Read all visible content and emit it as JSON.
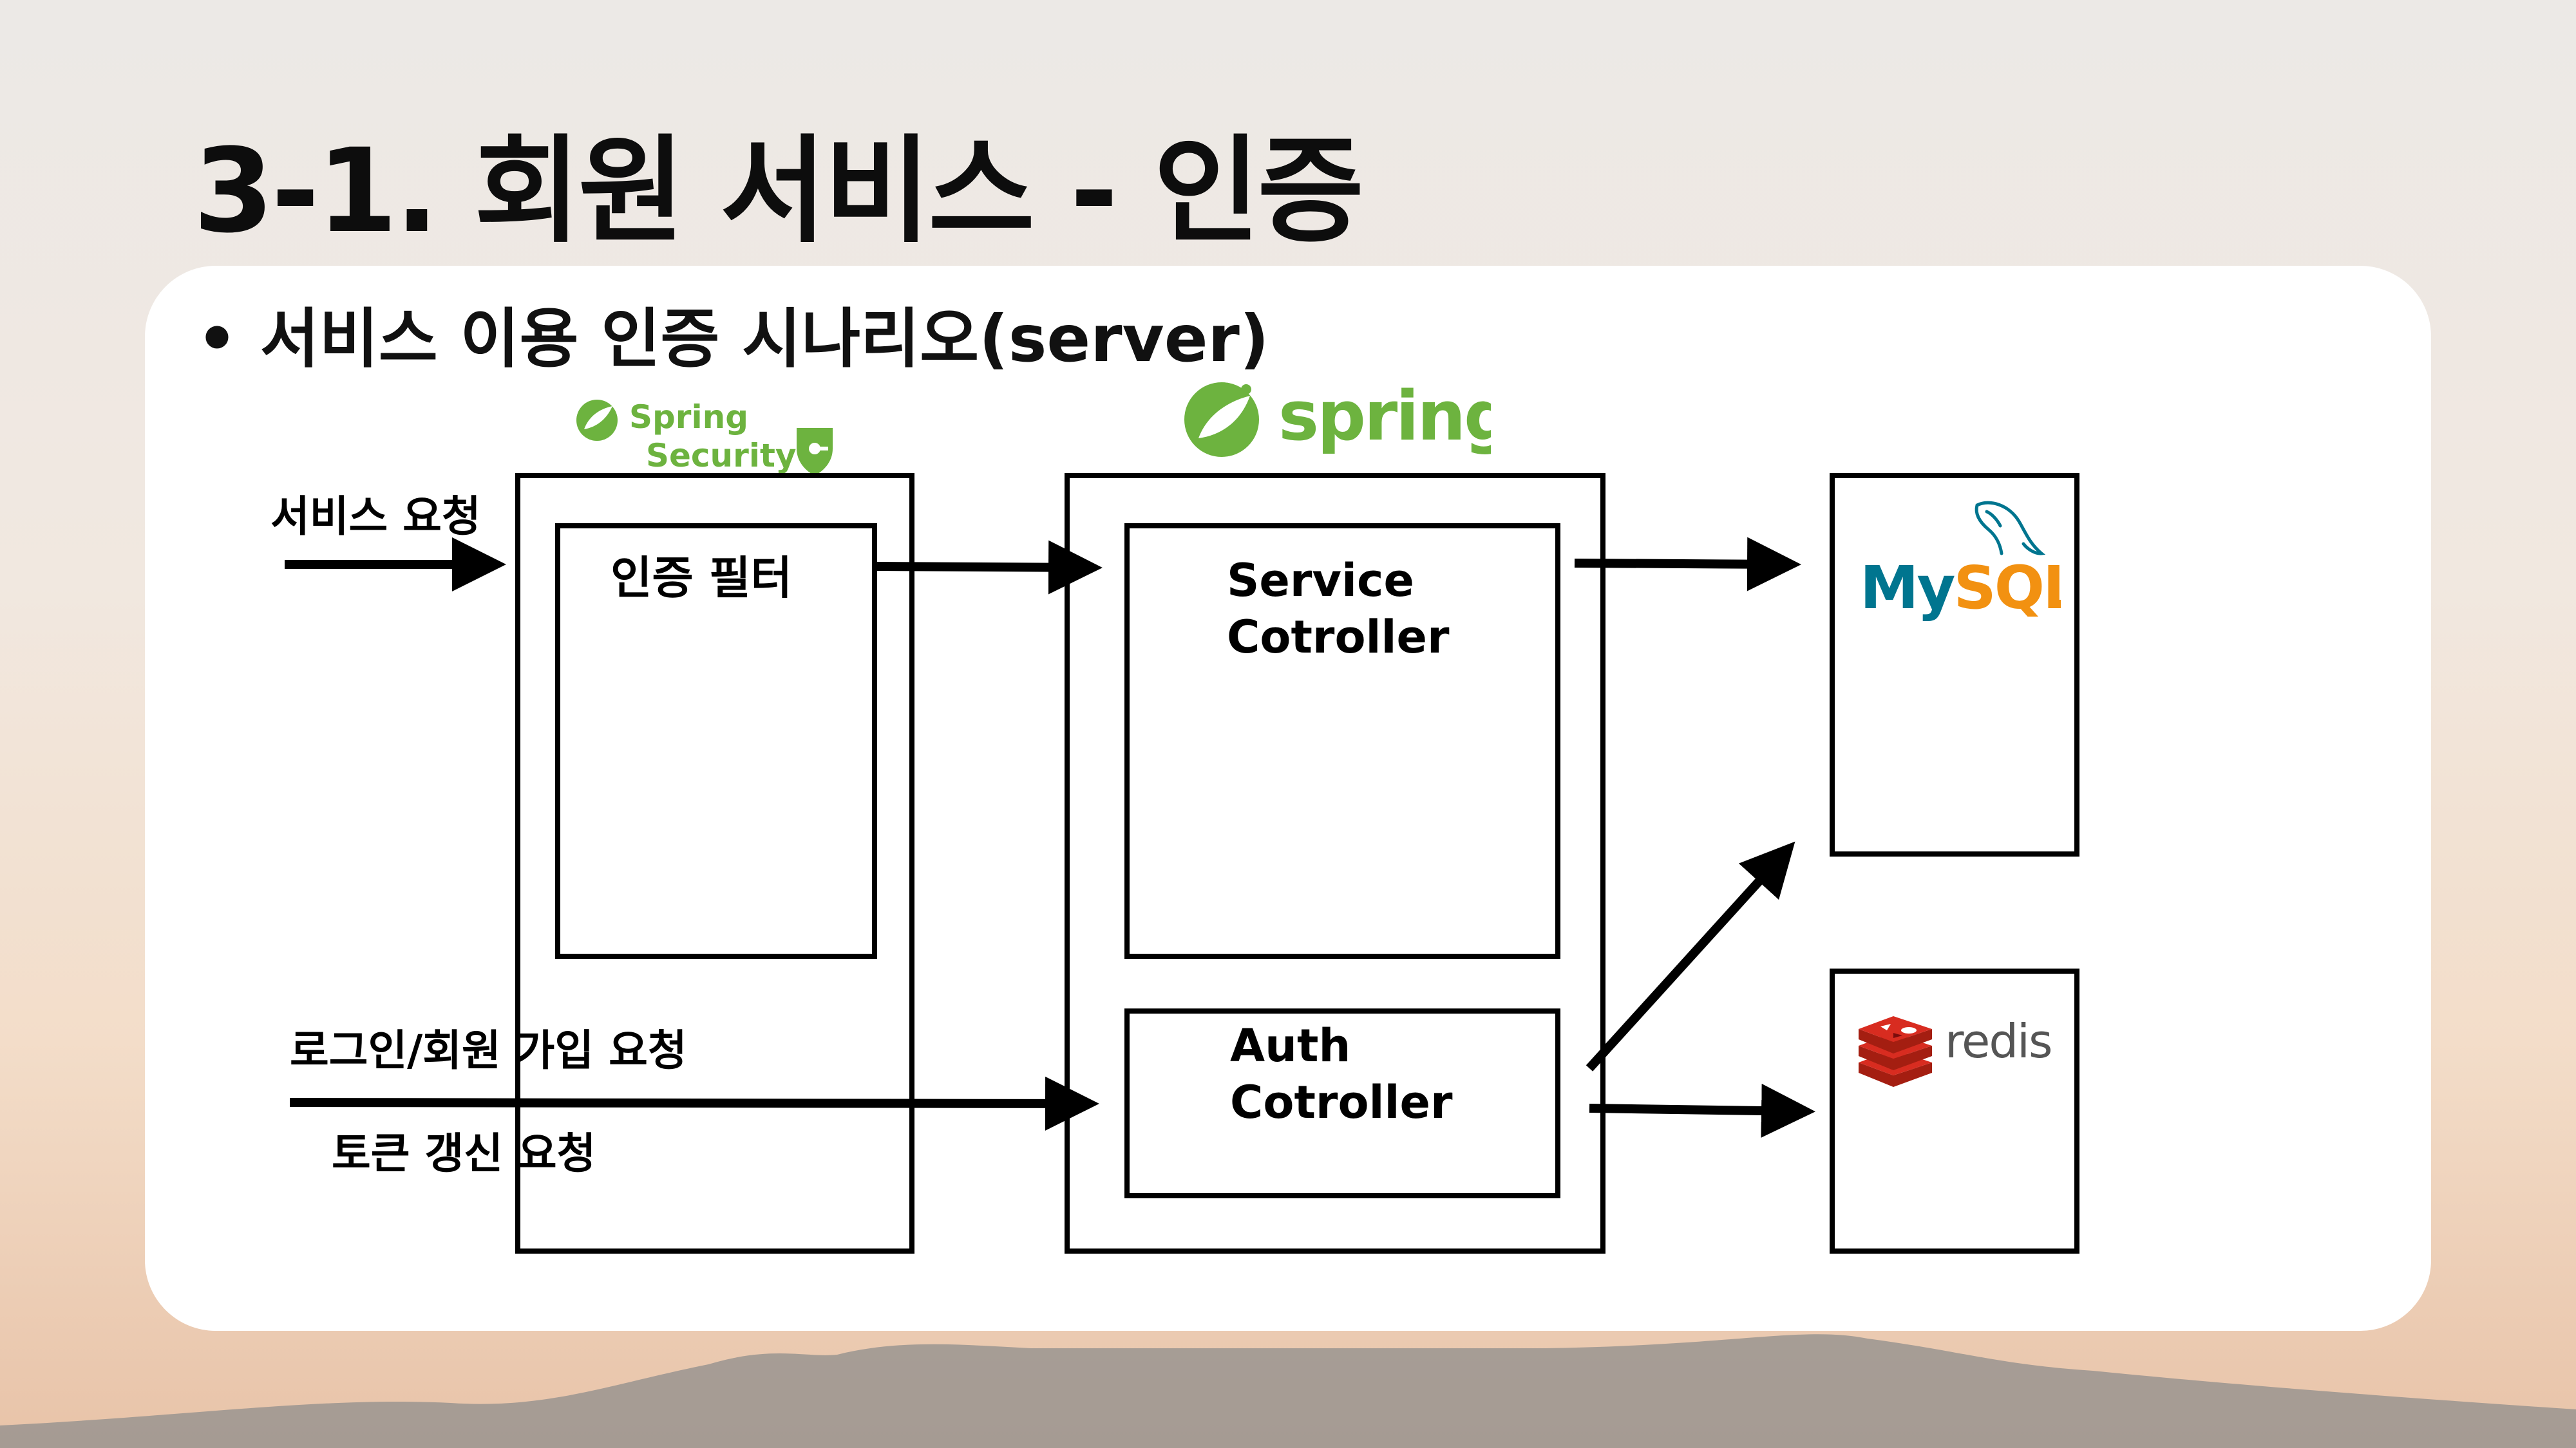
{
  "title": "3-1. 회원 서비스 - 인증",
  "subtitle": "• 서비스 이용 인증 시나리오(server)",
  "logos": {
    "spring_security": {
      "line1": "Spring",
      "line2": "Security"
    },
    "spring": "spring",
    "mysql": {
      "my": "My",
      "sql": "SQL",
      "tm": "™"
    },
    "redis": "redis"
  },
  "labels": {
    "service_request": "서비스 요청",
    "login_signup_request": "로그인/회원 가입 요청",
    "token_refresh_request": "토큰 갱신 요청",
    "auth_filter": "인증 필터",
    "service_controller_1": "Service",
    "service_controller_2": "Cotroller",
    "auth_controller_1": "Auth",
    "auth_controller_2": "Cotroller"
  },
  "colors": {
    "spring_green": "#6db33f",
    "mysql_blue": "#00758f",
    "mysql_orange": "#f29111",
    "redis_red": "#d82c20",
    "redis_gray": "#555555"
  }
}
